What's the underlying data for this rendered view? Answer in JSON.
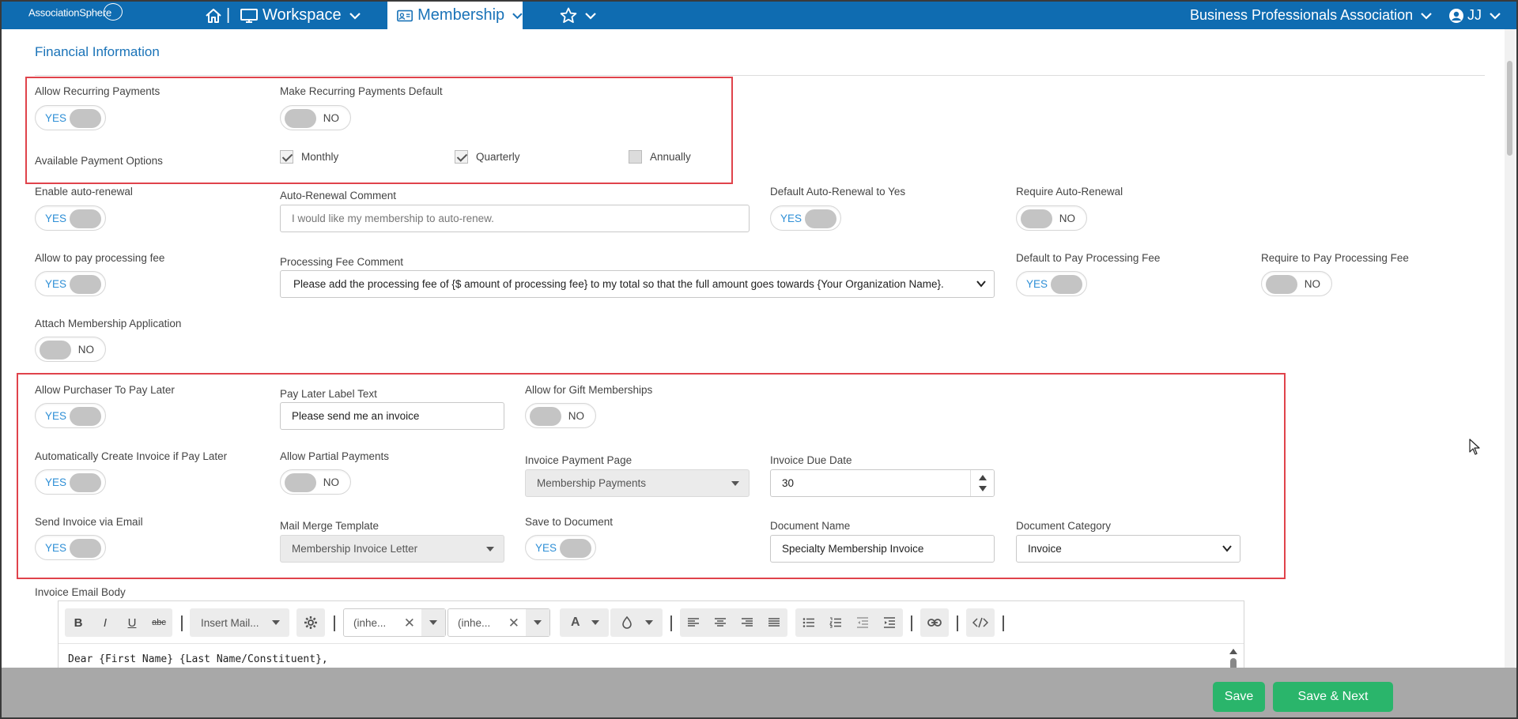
{
  "nav": {
    "logo_text": "AssociationSphere",
    "separator": "|",
    "workspace": "Workspace",
    "membership": "Membership",
    "org": "Business Professionals Association",
    "user": "JJ"
  },
  "section_title": "Financial Information",
  "fields": {
    "allow_recurring": {
      "label": "Allow Recurring Payments",
      "value": "YES"
    },
    "make_recurring_default": {
      "label": "Make Recurring Payments Default",
      "value": "NO"
    },
    "payment_options": {
      "label": "Available Payment Options",
      "options": [
        {
          "label": "Monthly",
          "checked": true
        },
        {
          "label": "Quarterly",
          "checked": true
        },
        {
          "label": "Annually",
          "checked": false
        }
      ]
    },
    "enable_auto_renewal": {
      "label": "Enable auto-renewal",
      "value": "YES"
    },
    "auto_renewal_comment": {
      "label": "Auto-Renewal Comment",
      "placeholder": "I would like my membership to auto-renew."
    },
    "default_auto_renewal": {
      "label": "Default Auto-Renewal to Yes",
      "value": "YES"
    },
    "require_auto_renewal": {
      "label": "Require Auto-Renewal",
      "value": "NO"
    },
    "allow_processing_fee": {
      "label": "Allow to pay processing fee",
      "value": "YES"
    },
    "processing_fee_comment": {
      "label": "Processing Fee Comment",
      "value": "Please add the processing fee of {$ amount of processing fee} to my total so that the full amount goes towards {Your Organization Name}."
    },
    "default_processing_fee": {
      "label": "Default to Pay Processing Fee",
      "value": "YES"
    },
    "require_processing_fee": {
      "label": "Require to Pay Processing Fee",
      "value": "NO"
    },
    "attach_application": {
      "label": "Attach Membership Application",
      "value": "NO"
    },
    "pay_later": {
      "label": "Allow Purchaser To Pay Later",
      "value": "YES"
    },
    "pay_later_label": {
      "label": "Pay Later Label Text",
      "value": "Please send me an invoice"
    },
    "gift_memberships": {
      "label": "Allow for Gift Memberships",
      "value": "NO"
    },
    "auto_invoice": {
      "label": "Automatically Create Invoice if Pay Later",
      "value": "YES"
    },
    "partial_payments": {
      "label": "Allow Partial Payments",
      "value": "NO"
    },
    "invoice_payment_page": {
      "label": "Invoice Payment Page",
      "value": "Membership Payments"
    },
    "invoice_due_date": {
      "label": "Invoice Due Date",
      "value": "30"
    },
    "send_invoice_email": {
      "label": "Send Invoice via Email",
      "value": "YES"
    },
    "mail_merge_template": {
      "label": "Mail Merge Template",
      "value": "Membership Invoice Letter"
    },
    "save_to_document": {
      "label": "Save to Document",
      "value": "YES"
    },
    "document_name": {
      "label": "Document Name",
      "value": "Specialty Membership Invoice"
    },
    "document_category": {
      "label": "Document Category",
      "value": "Invoice"
    },
    "invoice_email_body": {
      "label": "Invoice Email Body"
    }
  },
  "editor": {
    "bold": "B",
    "italic": "I",
    "underline": "U",
    "strike": "abc",
    "insert_mail": "Insert Mail...",
    "font_family": "(inhe...",
    "font_size": "(inhe...",
    "font_color": "A",
    "content": "Dear {First Name} {Last Name/Constituent},"
  },
  "footer": {
    "save": "Save",
    "save_next": "Save & Next"
  },
  "colors": {
    "nav_bg": "#0f6cb1",
    "accent": "#1a73b8",
    "highlight_box": "#e0434b",
    "save_button": "#2ab56b",
    "footer_bg": "#a8a8a8"
  }
}
